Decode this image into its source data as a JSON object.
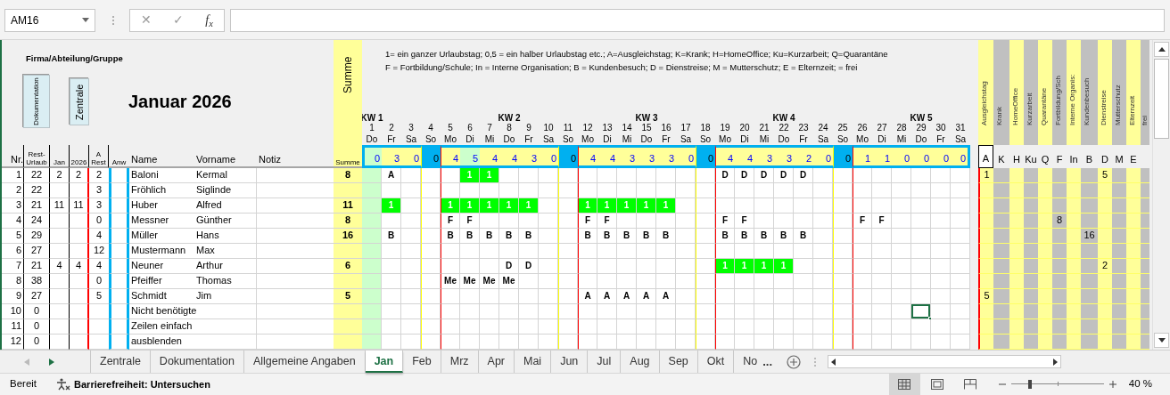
{
  "formula_bar": {
    "name_box": "AM16",
    "cancel": "✕",
    "confirm": "✓",
    "function": "f$_{x}$"
  },
  "sheet": {
    "group_label": "Firma/Abteilung/Gruppe",
    "buttons": [
      "Dokumentation",
      "Zentrale"
    ],
    "title": "Januar 2026",
    "legend": [
      "1= ein ganzer Urlaubstag; 0,5 = ein halber Urlaubstag etc.; A=Ausgleichstag; K=Krank; H=HomeOffice; Ku=Kurzarbeit; Q=Quarantäne",
      "F = Fortbildung/Schule; In = Interne Organisation; B = Kundenbesuch; D = Dienstreise; M = Mutterschutz; E = Elternzeit;  = frei"
    ],
    "sum_header": "Summe",
    "columns": {
      "nr": "Nr.",
      "rest": "Rest-Urlaub",
      "month": "Jan",
      "ytd": "2026",
      "a_rest": "A Rest",
      "attendance": "Anw",
      "name": "Name",
      "first_name": "Vorname",
      "note": "Notiz",
      "sum": "Summe"
    },
    "days": [
      {
        "kw": "KW 1",
        "num": "1",
        "wd": "Do",
        "kind": "weekday",
        "holiday": true,
        "new_week": false,
        "total": "0"
      },
      {
        "num": "2",
        "wd": "Fr",
        "kind": "weekday",
        "holiday": false,
        "new_week": false,
        "total": "3"
      },
      {
        "num": "3",
        "wd": "Sa",
        "kind": "saturday",
        "holiday": false,
        "new_week": false,
        "total": "0"
      },
      {
        "num": "4",
        "wd": "So",
        "kind": "sunday",
        "holiday": false,
        "new_week": false,
        "total": "0"
      },
      {
        "num": "5",
        "wd": "Mo",
        "kind": "weekday",
        "holiday": false,
        "new_week": true,
        "total": "4"
      },
      {
        "num": "6",
        "wd": "Di",
        "kind": "weekday",
        "holiday": true,
        "new_week": false,
        "total": "5"
      },
      {
        "num": "7",
        "wd": "Mi",
        "kind": "weekday",
        "holiday": false,
        "new_week": false,
        "total": "4"
      },
      {
        "kw": "KW 2",
        "num": "8",
        "wd": "Do",
        "kind": "weekday",
        "holiday": false,
        "new_week": false,
        "total": "4"
      },
      {
        "num": "9",
        "wd": "Fr",
        "kind": "weekday",
        "holiday": false,
        "new_week": false,
        "total": "3"
      },
      {
        "num": "10",
        "wd": "Sa",
        "kind": "saturday",
        "holiday": false,
        "new_week": false,
        "total": "0"
      },
      {
        "num": "11",
        "wd": "So",
        "kind": "sunday",
        "holiday": false,
        "new_week": false,
        "total": "0"
      },
      {
        "num": "12",
        "wd": "Mo",
        "kind": "weekday",
        "holiday": false,
        "new_week": true,
        "total": "4"
      },
      {
        "num": "13",
        "wd": "Di",
        "kind": "weekday",
        "holiday": false,
        "new_week": false,
        "total": "4"
      },
      {
        "num": "14",
        "wd": "Mi",
        "kind": "weekday",
        "holiday": false,
        "new_week": false,
        "total": "3"
      },
      {
        "kw": "KW 3",
        "num": "15",
        "wd": "Do",
        "kind": "weekday",
        "holiday": false,
        "new_week": false,
        "total": "3"
      },
      {
        "num": "16",
        "wd": "Fr",
        "kind": "weekday",
        "holiday": false,
        "new_week": false,
        "total": "3"
      },
      {
        "num": "17",
        "wd": "Sa",
        "kind": "saturday",
        "holiday": false,
        "new_week": false,
        "total": "0"
      },
      {
        "num": "18",
        "wd": "So",
        "kind": "sunday",
        "holiday": false,
        "new_week": false,
        "total": "0"
      },
      {
        "num": "19",
        "wd": "Mo",
        "kind": "weekday",
        "holiday": false,
        "new_week": true,
        "total": "4"
      },
      {
        "num": "20",
        "wd": "Di",
        "kind": "weekday",
        "holiday": false,
        "new_week": false,
        "total": "4"
      },
      {
        "num": "21",
        "wd": "Mi",
        "kind": "weekday",
        "holiday": false,
        "new_week": false,
        "total": "3"
      },
      {
        "kw": "KW 4",
        "num": "22",
        "wd": "Do",
        "kind": "weekday",
        "holiday": false,
        "new_week": false,
        "total": "3"
      },
      {
        "num": "23",
        "wd": "Fr",
        "kind": "weekday",
        "holiday": false,
        "new_week": false,
        "total": "2"
      },
      {
        "num": "24",
        "wd": "Sa",
        "kind": "saturday",
        "holiday": false,
        "new_week": false,
        "total": "0"
      },
      {
        "num": "25",
        "wd": "So",
        "kind": "sunday",
        "holiday": false,
        "new_week": false,
        "total": "0"
      },
      {
        "num": "26",
        "wd": "Mo",
        "kind": "weekday",
        "holiday": false,
        "new_week": true,
        "total": "1"
      },
      {
        "num": "27",
        "wd": "Di",
        "kind": "weekday",
        "holiday": false,
        "new_week": false,
        "total": "1"
      },
      {
        "num": "28",
        "wd": "Mi",
        "kind": "weekday",
        "holiday": false,
        "new_week": false,
        "total": "0"
      },
      {
        "kw": "KW 5",
        "num": "29",
        "wd": "Do",
        "kind": "weekday",
        "holiday": false,
        "new_week": false,
        "total": "0"
      },
      {
        "num": "30",
        "wd": "Fr",
        "kind": "weekday",
        "holiday": false,
        "new_week": false,
        "total": "0"
      },
      {
        "num": "31",
        "wd": "Sa",
        "kind": "saturday",
        "holiday": false,
        "new_week": false,
        "total": "0"
      }
    ],
    "categories": [
      {
        "label": "Ausgleichstag",
        "letter": "A",
        "color": "#ffff99"
      },
      {
        "label": "Krank",
        "letter": "K",
        "color": "#c0c0c0"
      },
      {
        "label": "HomeOffice",
        "letter": "H",
        "color": "#ffff99"
      },
      {
        "label": "Kurzarbeit",
        "letter": "Ku",
        "color": "#c0c0c0"
      },
      {
        "label": "Quarantäne",
        "letter": "Q",
        "color": "#ffff99"
      },
      {
        "label": "Fortbildung/Sch",
        "letter": "F",
        "color": "#c0c0c0"
      },
      {
        "label": "Interne Organis:",
        "letter": "In",
        "color": "#ffff99"
      },
      {
        "label": "Kundenbesuch",
        "letter": "B",
        "color": "#c0c0c0"
      },
      {
        "label": "Dienstreise",
        "letter": "D",
        "color": "#ffff99"
      },
      {
        "label": "Mutterschutz",
        "letter": "M",
        "color": "#c0c0c0"
      },
      {
        "label": "Elternzeit",
        "letter": "E",
        "color": "#ffff99"
      },
      {
        "label": "frei",
        "color": "#c0c0c0"
      }
    ],
    "employees": [
      {
        "nr": "1",
        "rest": "22",
        "month": "2",
        "ytd": "2",
        "a_rest": "2",
        "name": "Baloni",
        "first_name": "Kermal",
        "sum": "8",
        "cells": [
          {
            "kind": "empty",
            "selected": false
          },
          {
            "code": "A",
            "kind": "letter",
            "selected": false
          },
          {
            "kind": "empty",
            "selected": false
          },
          {
            "kind": "empty",
            "selected": false
          },
          {
            "kind": "empty",
            "selected": false
          },
          {
            "code": "1",
            "kind": "vacation",
            "selected": false
          },
          {
            "code": "1",
            "kind": "vacation",
            "selected": false
          },
          {
            "kind": "empty",
            "selected": false
          },
          {
            "kind": "empty",
            "selected": false
          },
          {
            "kind": "empty",
            "selected": false
          },
          {
            "kind": "empty",
            "selected": false
          },
          {
            "kind": "empty",
            "selected": false
          },
          {
            "kind": "empty",
            "selected": false
          },
          {
            "kind": "empty",
            "selected": false
          },
          {
            "kind": "empty",
            "selected": false
          },
          {
            "kind": "empty",
            "selected": false
          },
          {
            "kind": "empty",
            "selected": false
          },
          {
            "kind": "empty",
            "selected": false
          },
          {
            "code": "D",
            "kind": "letter",
            "selected": false
          },
          {
            "code": "D",
            "kind": "letter",
            "selected": false
          },
          {
            "code": "D",
            "kind": "letter",
            "selected": false
          },
          {
            "code": "D",
            "kind": "letter",
            "selected": false
          },
          {
            "code": "D",
            "kind": "letter",
            "selected": false
          },
          {
            "kind": "empty",
            "selected": false
          },
          {
            "kind": "empty",
            "selected": false
          },
          {
            "kind": "empty",
            "selected": false
          },
          {
            "kind": "empty",
            "selected": false
          },
          {
            "kind": "empty",
            "selected": false
          },
          {
            "kind": "empty",
            "selected": false
          },
          {
            "kind": "empty",
            "selected": false
          },
          {
            "kind": "empty",
            "selected": false
          }
        ],
        "totals": [
          {
            "kind": "number",
            "value": "1"
          },
          {
            "kind": "blank"
          },
          {
            "kind": "blank"
          },
          {
            "kind": "blank"
          },
          {
            "kind": "blank"
          },
          {
            "kind": "blank"
          },
          {
            "kind": "blank"
          },
          {
            "kind": "blank"
          },
          {
            "kind": "number",
            "value": "5"
          },
          {
            "kind": "blank"
          },
          {
            "kind": "blank"
          },
          {
            "kind": "blank"
          }
        ]
      },
      {
        "nr": "2",
        "rest": "22",
        "a_rest": "3",
        "name": "Fröhlich",
        "first_name": "Siglinde"
      },
      {
        "nr": "3",
        "rest": "21",
        "month": "11",
        "ytd": "11",
        "a_rest": "3",
        "name": "Huber",
        "first_name": "Alfred",
        "sum": "11",
        "cells": [
          {
            "kind": "empty",
            "selected": false
          },
          {
            "code": "1",
            "kind": "vacation",
            "selected": false
          },
          {
            "kind": "empty",
            "selected": false
          },
          {
            "kind": "empty",
            "selected": false
          },
          {
            "code": "1",
            "kind": "vacation",
            "selected": false
          },
          {
            "code": "1",
            "kind": "vacation",
            "selected": false
          },
          {
            "code": "1",
            "kind": "vacation",
            "selected": false
          },
          {
            "code": "1",
            "kind": "vacation",
            "selected": false
          },
          {
            "code": "1",
            "kind": "vacation",
            "selected": false
          },
          {
            "kind": "empty",
            "selected": false
          },
          {
            "kind": "empty",
            "selected": false
          },
          {
            "code": "1",
            "kind": "vacation",
            "selected": false
          },
          {
            "code": "1",
            "kind": "vacation",
            "selected": false
          },
          {
            "code": "1",
            "kind": "vacation",
            "selected": false
          },
          {
            "code": "1",
            "kind": "vacation",
            "selected": false
          },
          {
            "code": "1",
            "kind": "vacation",
            "selected": false
          },
          {
            "kind": "empty",
            "selected": false
          },
          {
            "kind": "empty",
            "selected": false
          },
          {
            "kind": "empty",
            "selected": false
          },
          {
            "kind": "empty",
            "selected": false
          },
          {
            "kind": "empty",
            "selected": false
          },
          {
            "kind": "empty",
            "selected": false
          },
          {
            "kind": "empty",
            "selected": false
          },
          {
            "kind": "empty",
            "selected": false
          },
          {
            "kind": "empty",
            "selected": false
          },
          {
            "kind": "empty",
            "selected": false
          },
          {
            "kind": "empty",
            "selected": false
          },
          {
            "kind": "empty",
            "selected": false
          },
          {
            "kind": "empty",
            "selected": false
          },
          {
            "kind": "empty",
            "selected": false
          },
          {
            "kind": "empty",
            "selected": false
          }
        ]
      },
      {
        "nr": "4",
        "rest": "24",
        "a_rest": "0",
        "name": "Messner",
        "first_name": "Günther",
        "sum": "8",
        "cells": [
          {
            "kind": "empty",
            "selected": false
          },
          {
            "kind": "empty",
            "selected": false
          },
          {
            "kind": "empty",
            "selected": false
          },
          {
            "kind": "empty",
            "selected": false
          },
          {
            "code": "F",
            "kind": "letter",
            "selected": false
          },
          {
            "code": "F",
            "kind": "letter",
            "selected": false
          },
          {
            "kind": "empty",
            "selected": false
          },
          {
            "kind": "empty",
            "selected": false
          },
          {
            "kind": "empty",
            "selected": false
          },
          {
            "kind": "empty",
            "selected": false
          },
          {
            "kind": "empty",
            "selected": false
          },
          {
            "code": "F",
            "kind": "letter",
            "selected": false
          },
          {
            "code": "F",
            "kind": "letter",
            "selected": false
          },
          {
            "kind": "empty",
            "selected": false
          },
          {
            "kind": "empty",
            "selected": false
          },
          {
            "kind": "empty",
            "selected": false
          },
          {
            "kind": "empty",
            "selected": false
          },
          {
            "kind": "empty",
            "selected": false
          },
          {
            "code": "F",
            "kind": "letter",
            "selected": false
          },
          {
            "code": "F",
            "kind": "letter",
            "selected": false
          },
          {
            "kind": "empty",
            "selected": false
          },
          {
            "kind": "empty",
            "selected": false
          },
          {
            "kind": "empty",
            "selected": false
          },
          {
            "kind": "empty",
            "selected": false
          },
          {
            "kind": "empty",
            "selected": false
          },
          {
            "code": "F",
            "kind": "letter",
            "selected": false
          },
          {
            "code": "F",
            "kind": "letter",
            "selected": false
          },
          {
            "kind": "empty",
            "selected": false
          },
          {
            "kind": "empty",
            "selected": false
          },
          {
            "kind": "empty",
            "selected": false
          },
          {
            "kind": "empty",
            "selected": false
          }
        ],
        "totals": [
          {
            "kind": "blank"
          },
          {
            "kind": "blank"
          },
          {
            "kind": "blank"
          },
          {
            "kind": "blank"
          },
          {
            "kind": "blank"
          },
          {
            "kind": "number",
            "value": "8"
          },
          {
            "kind": "blank"
          },
          {
            "kind": "blank"
          },
          {
            "kind": "blank"
          },
          {
            "kind": "blank"
          },
          {
            "kind": "blank"
          },
          {
            "kind": "blank"
          }
        ]
      },
      {
        "nr": "5",
        "rest": "29",
        "a_rest": "4",
        "name": "Müller",
        "first_name": "Hans",
        "sum": "16",
        "cells": [
          {
            "kind": "empty",
            "selected": false
          },
          {
            "code": "B",
            "kind": "letter",
            "selected": false
          },
          {
            "kind": "empty",
            "selected": false
          },
          {
            "kind": "empty",
            "selected": false
          },
          {
            "code": "B",
            "kind": "letter",
            "selected": false
          },
          {
            "code": "B",
            "kind": "letter",
            "selected": false
          },
          {
            "code": "B",
            "kind": "letter",
            "selected": false
          },
          {
            "code": "B",
            "kind": "letter",
            "selected": false
          },
          {
            "code": "B",
            "kind": "letter",
            "selected": false
          },
          {
            "kind": "empty",
            "selected": false
          },
          {
            "kind": "empty",
            "selected": false
          },
          {
            "code": "B",
            "kind": "letter",
            "selected": false
          },
          {
            "code": "B",
            "kind": "letter",
            "selected": false
          },
          {
            "code": "B",
            "kind": "letter",
            "selected": false
          },
          {
            "code": "B",
            "kind": "letter",
            "selected": false
          },
          {
            "code": "B",
            "kind": "letter",
            "selected": false
          },
          {
            "kind": "empty",
            "selected": false
          },
          {
            "kind": "empty",
            "selected": false
          },
          {
            "code": "B",
            "kind": "letter",
            "selected": false
          },
          {
            "code": "B",
            "kind": "letter",
            "selected": false
          },
          {
            "code": "B",
            "kind": "letter",
            "selected": false
          },
          {
            "code": "B",
            "kind": "letter",
            "selected": false
          },
          {
            "code": "B",
            "kind": "letter",
            "selected": false
          },
          {
            "kind": "empty",
            "selected": false
          },
          {
            "kind": "empty",
            "selected": false
          },
          {
            "kind": "empty",
            "selected": false
          },
          {
            "kind": "empty",
            "selected": false
          },
          {
            "kind": "empty",
            "selected": false
          },
          {
            "kind": "empty",
            "selected": false
          },
          {
            "kind": "empty",
            "selected": false
          },
          {
            "kind": "empty",
            "selected": false
          }
        ],
        "totals": [
          {
            "kind": "blank"
          },
          {
            "kind": "blank"
          },
          {
            "kind": "blank"
          },
          {
            "kind": "blank"
          },
          {
            "kind": "blank"
          },
          {
            "kind": "blank"
          },
          {
            "kind": "blank"
          },
          {
            "kind": "number",
            "value": "16"
          },
          {
            "kind": "blank"
          },
          {
            "kind": "blank"
          },
          {
            "kind": "blank"
          },
          {
            "kind": "blank"
          }
        ]
      },
      {
        "nr": "6",
        "rest": "27",
        "a_rest": "12",
        "name": "Mustermann",
        "first_name": "Max"
      },
      {
        "nr": "7",
        "rest": "21",
        "month": "4",
        "ytd": "4",
        "a_rest": "4",
        "name": "Neuner",
        "first_name": "Arthur",
        "sum": "6",
        "cells": [
          {
            "kind": "empty",
            "selected": false
          },
          {
            "kind": "empty",
            "selected": false
          },
          {
            "kind": "empty",
            "selected": false
          },
          {
            "kind": "empty",
            "selected": false
          },
          {
            "kind": "empty",
            "selected": false
          },
          {
            "kind": "empty",
            "selected": false
          },
          {
            "kind": "empty",
            "selected": false
          },
          {
            "code": "D",
            "kind": "letter",
            "selected": false
          },
          {
            "code": "D",
            "kind": "letter",
            "selected": false
          },
          {
            "kind": "empty",
            "selected": false
          },
          {
            "kind": "empty",
            "selected": false
          },
          {
            "kind": "empty",
            "selected": false
          },
          {
            "kind": "empty",
            "selected": false
          },
          {
            "kind": "empty",
            "selected": false
          },
          {
            "kind": "empty",
            "selected": false
          },
          {
            "kind": "empty",
            "selected": false
          },
          {
            "kind": "empty",
            "selected": false
          },
          {
            "kind": "empty",
            "selected": false
          },
          {
            "code": "1",
            "kind": "vacation",
            "selected": false
          },
          {
            "code": "1",
            "kind": "vacation",
            "selected": false
          },
          {
            "code": "1",
            "kind": "vacation",
            "selected": false
          },
          {
            "code": "1",
            "kind": "vacation",
            "selected": false
          },
          {
            "kind": "empty",
            "selected": false
          },
          {
            "kind": "empty",
            "selected": false
          },
          {
            "kind": "empty",
            "selected": false
          },
          {
            "kind": "empty",
            "selected": false
          },
          {
            "kind": "empty",
            "selected": false
          },
          {
            "kind": "empty",
            "selected": false
          },
          {
            "kind": "empty",
            "selected": false
          },
          {
            "kind": "empty",
            "selected": false
          },
          {
            "kind": "empty",
            "selected": false
          }
        ],
        "totals": [
          {
            "kind": "blank"
          },
          {
            "kind": "blank"
          },
          {
            "kind": "blank"
          },
          {
            "kind": "blank"
          },
          {
            "kind": "blank"
          },
          {
            "kind": "blank"
          },
          {
            "kind": "blank"
          },
          {
            "kind": "blank"
          },
          {
            "kind": "number",
            "value": "2"
          },
          {
            "kind": "blank"
          },
          {
            "kind": "blank"
          },
          {
            "kind": "blank"
          }
        ]
      },
      {
        "nr": "8",
        "rest": "38",
        "a_rest": "0",
        "name": "Pfeiffer",
        "first_name": "Thomas",
        "cells": [
          {
            "kind": "empty",
            "selected": false
          },
          {
            "kind": "empty",
            "selected": false
          },
          {
            "kind": "empty",
            "selected": false
          },
          {
            "kind": "empty",
            "selected": false
          },
          {
            "code": "Me",
            "kind": "letter",
            "selected": false
          },
          {
            "code": "Me",
            "kind": "letter",
            "selected": false
          },
          {
            "code": "Me",
            "kind": "letter",
            "selected": false
          },
          {
            "code": "Me",
            "kind": "letter",
            "selected": false
          },
          {
            "kind": "empty",
            "selected": false
          },
          {
            "kind": "empty",
            "selected": false
          },
          {
            "kind": "empty",
            "selected": false
          },
          {
            "kind": "empty",
            "selected": false
          },
          {
            "kind": "empty",
            "selected": false
          },
          {
            "kind": "empty",
            "selected": false
          },
          {
            "kind": "empty",
            "selected": false
          },
          {
            "kind": "empty",
            "selected": false
          },
          {
            "kind": "empty",
            "selected": false
          },
          {
            "kind": "empty",
            "selected": false
          },
          {
            "kind": "empty",
            "selected": false
          },
          {
            "kind": "empty",
            "selected": false
          },
          {
            "kind": "empty",
            "selected": false
          },
          {
            "kind": "empty",
            "selected": false
          },
          {
            "kind": "empty",
            "selected": false
          },
          {
            "kind": "empty",
            "selected": false
          },
          {
            "kind": "empty",
            "selected": false
          },
          {
            "kind": "empty",
            "selected": false
          },
          {
            "kind": "empty",
            "selected": false
          },
          {
            "kind": "empty",
            "selected": false
          },
          {
            "kind": "empty",
            "selected": false
          },
          {
            "kind": "empty",
            "selected": false
          },
          {
            "kind": "empty",
            "selected": false
          }
        ]
      },
      {
        "nr": "9",
        "rest": "27",
        "a_rest": "5",
        "name": "Schmidt",
        "first_name": "Jim",
        "sum": "5",
        "cells": [
          {
            "kind": "empty",
            "selected": false
          },
          {
            "kind": "empty",
            "selected": false
          },
          {
            "kind": "empty",
            "selected": false
          },
          {
            "kind": "empty",
            "selected": false
          },
          {
            "kind": "empty",
            "selected": false
          },
          {
            "kind": "empty",
            "selected": false
          },
          {
            "kind": "empty",
            "selected": false
          },
          {
            "kind": "empty",
            "selected": false
          },
          {
            "kind": "empty",
            "selected": false
          },
          {
            "kind": "empty",
            "selected": false
          },
          {
            "kind": "empty",
            "selected": false
          },
          {
            "code": "A",
            "kind": "letter",
            "selected": false
          },
          {
            "code": "A",
            "kind": "letter",
            "selected": false
          },
          {
            "code": "A",
            "kind": "letter",
            "selected": false
          },
          {
            "code": "A",
            "kind": "letter",
            "selected": false
          },
          {
            "code": "A",
            "kind": "letter",
            "selected": false
          },
          {
            "kind": "empty",
            "selected": false
          },
          {
            "kind": "empty",
            "selected": false
          },
          {
            "kind": "empty",
            "selected": false
          },
          {
            "kind": "empty",
            "selected": false
          },
          {
            "kind": "empty",
            "selected": false
          },
          {
            "kind": "empty",
            "selected": false
          },
          {
            "kind": "empty",
            "selected": false
          },
          {
            "kind": "empty",
            "selected": false
          },
          {
            "kind": "empty",
            "selected": false
          },
          {
            "kind": "empty",
            "selected": false
          },
          {
            "kind": "empty",
            "selected": false
          },
          {
            "kind": "empty",
            "selected": false
          },
          {
            "kind": "empty",
            "selected": false
          },
          {
            "kind": "empty",
            "selected": false
          },
          {
            "kind": "empty",
            "selected": false
          }
        ],
        "totals": [
          {
            "kind": "number",
            "value": "5"
          },
          {
            "kind": "blank"
          },
          {
            "kind": "blank"
          },
          {
            "kind": "blank"
          },
          {
            "kind": "blank"
          },
          {
            "kind": "blank"
          },
          {
            "kind": "blank"
          },
          {
            "kind": "blank"
          },
          {
            "kind": "blank"
          },
          {
            "kind": "blank"
          },
          {
            "kind": "blank"
          },
          {
            "kind": "blank"
          }
        ]
      },
      {
        "nr": "10",
        "rest": "0",
        "name": "Nicht benötigte",
        "cells": [
          {
            "kind": "empty",
            "selected": false
          },
          {
            "kind": "empty",
            "selected": false
          },
          {
            "kind": "empty",
            "selected": false
          },
          {
            "kind": "empty",
            "selected": false
          },
          {
            "kind": "empty",
            "selected": false
          },
          {
            "kind": "empty",
            "selected": false
          },
          {
            "kind": "empty",
            "selected": false
          },
          {
            "kind": "empty",
            "selected": false
          },
          {
            "kind": "empty",
            "selected": false
          },
          {
            "kind": "empty",
            "selected": false
          },
          {
            "kind": "empty",
            "selected": false
          },
          {
            "kind": "empty",
            "selected": false
          },
          {
            "kind": "empty",
            "selected": false
          },
          {
            "kind": "empty",
            "selected": false
          },
          {
            "kind": "empty",
            "selected": false
          },
          {
            "kind": "empty",
            "selected": false
          },
          {
            "kind": "empty",
            "selected": false
          },
          {
            "kind": "empty",
            "selected": false
          },
          {
            "kind": "empty",
            "selected": false
          },
          {
            "kind": "empty",
            "selected": false
          },
          {
            "kind": "empty",
            "selected": false
          },
          {
            "kind": "empty",
            "selected": false
          },
          {
            "kind": "empty",
            "selected": false
          },
          {
            "kind": "empty",
            "selected": false
          },
          {
            "kind": "empty",
            "selected": false
          },
          {
            "kind": "empty",
            "selected": false
          },
          {
            "kind": "empty",
            "selected": false
          },
          {
            "kind": "empty",
            "selected": false
          },
          {
            "kind": "empty",
            "selected": true
          },
          {
            "kind": "empty",
            "selected": false
          },
          {
            "kind": "empty",
            "selected": false
          }
        ]
      },
      {
        "nr": "11",
        "rest": "0",
        "name": "Zeilen einfach"
      },
      {
        "nr": "12",
        "rest": "0",
        "name": "ausblenden"
      }
    ]
  },
  "sheet_tabs": {
    "tabs": [
      {
        "label": "Zentrale",
        "selected": false
      },
      {
        "label": "Dokumentation",
        "selected": false
      },
      {
        "label": "Allgemeine Angaben",
        "selected": false
      },
      {
        "label": "Jan",
        "selected": true
      },
      {
        "label": "Feb",
        "selected": false
      },
      {
        "label": "Mrz",
        "selected": false
      },
      {
        "label": "Apr",
        "selected": false
      },
      {
        "label": "Mai",
        "selected": false
      },
      {
        "label": "Jun",
        "selected": false
      },
      {
        "label": "Jul",
        "selected": false
      },
      {
        "label": "Aug",
        "selected": false
      },
      {
        "label": "Sep",
        "selected": false
      },
      {
        "label": "Okt",
        "selected": false
      },
      {
        "label": "No",
        "selected": false
      }
    ],
    "more": "..."
  },
  "status_bar": {
    "ready": "Bereit",
    "accessibility": "Barrierefreiheit: Untersuchen",
    "zoom": "40 %",
    "zoom_level": {
      "level": 0.2
    },
    "views": [
      {
        "kind": "normal",
        "selected": true
      },
      {
        "kind": "layout",
        "selected": false
      },
      {
        "kind": "pagebreak",
        "selected": false
      }
    ]
  }
}
